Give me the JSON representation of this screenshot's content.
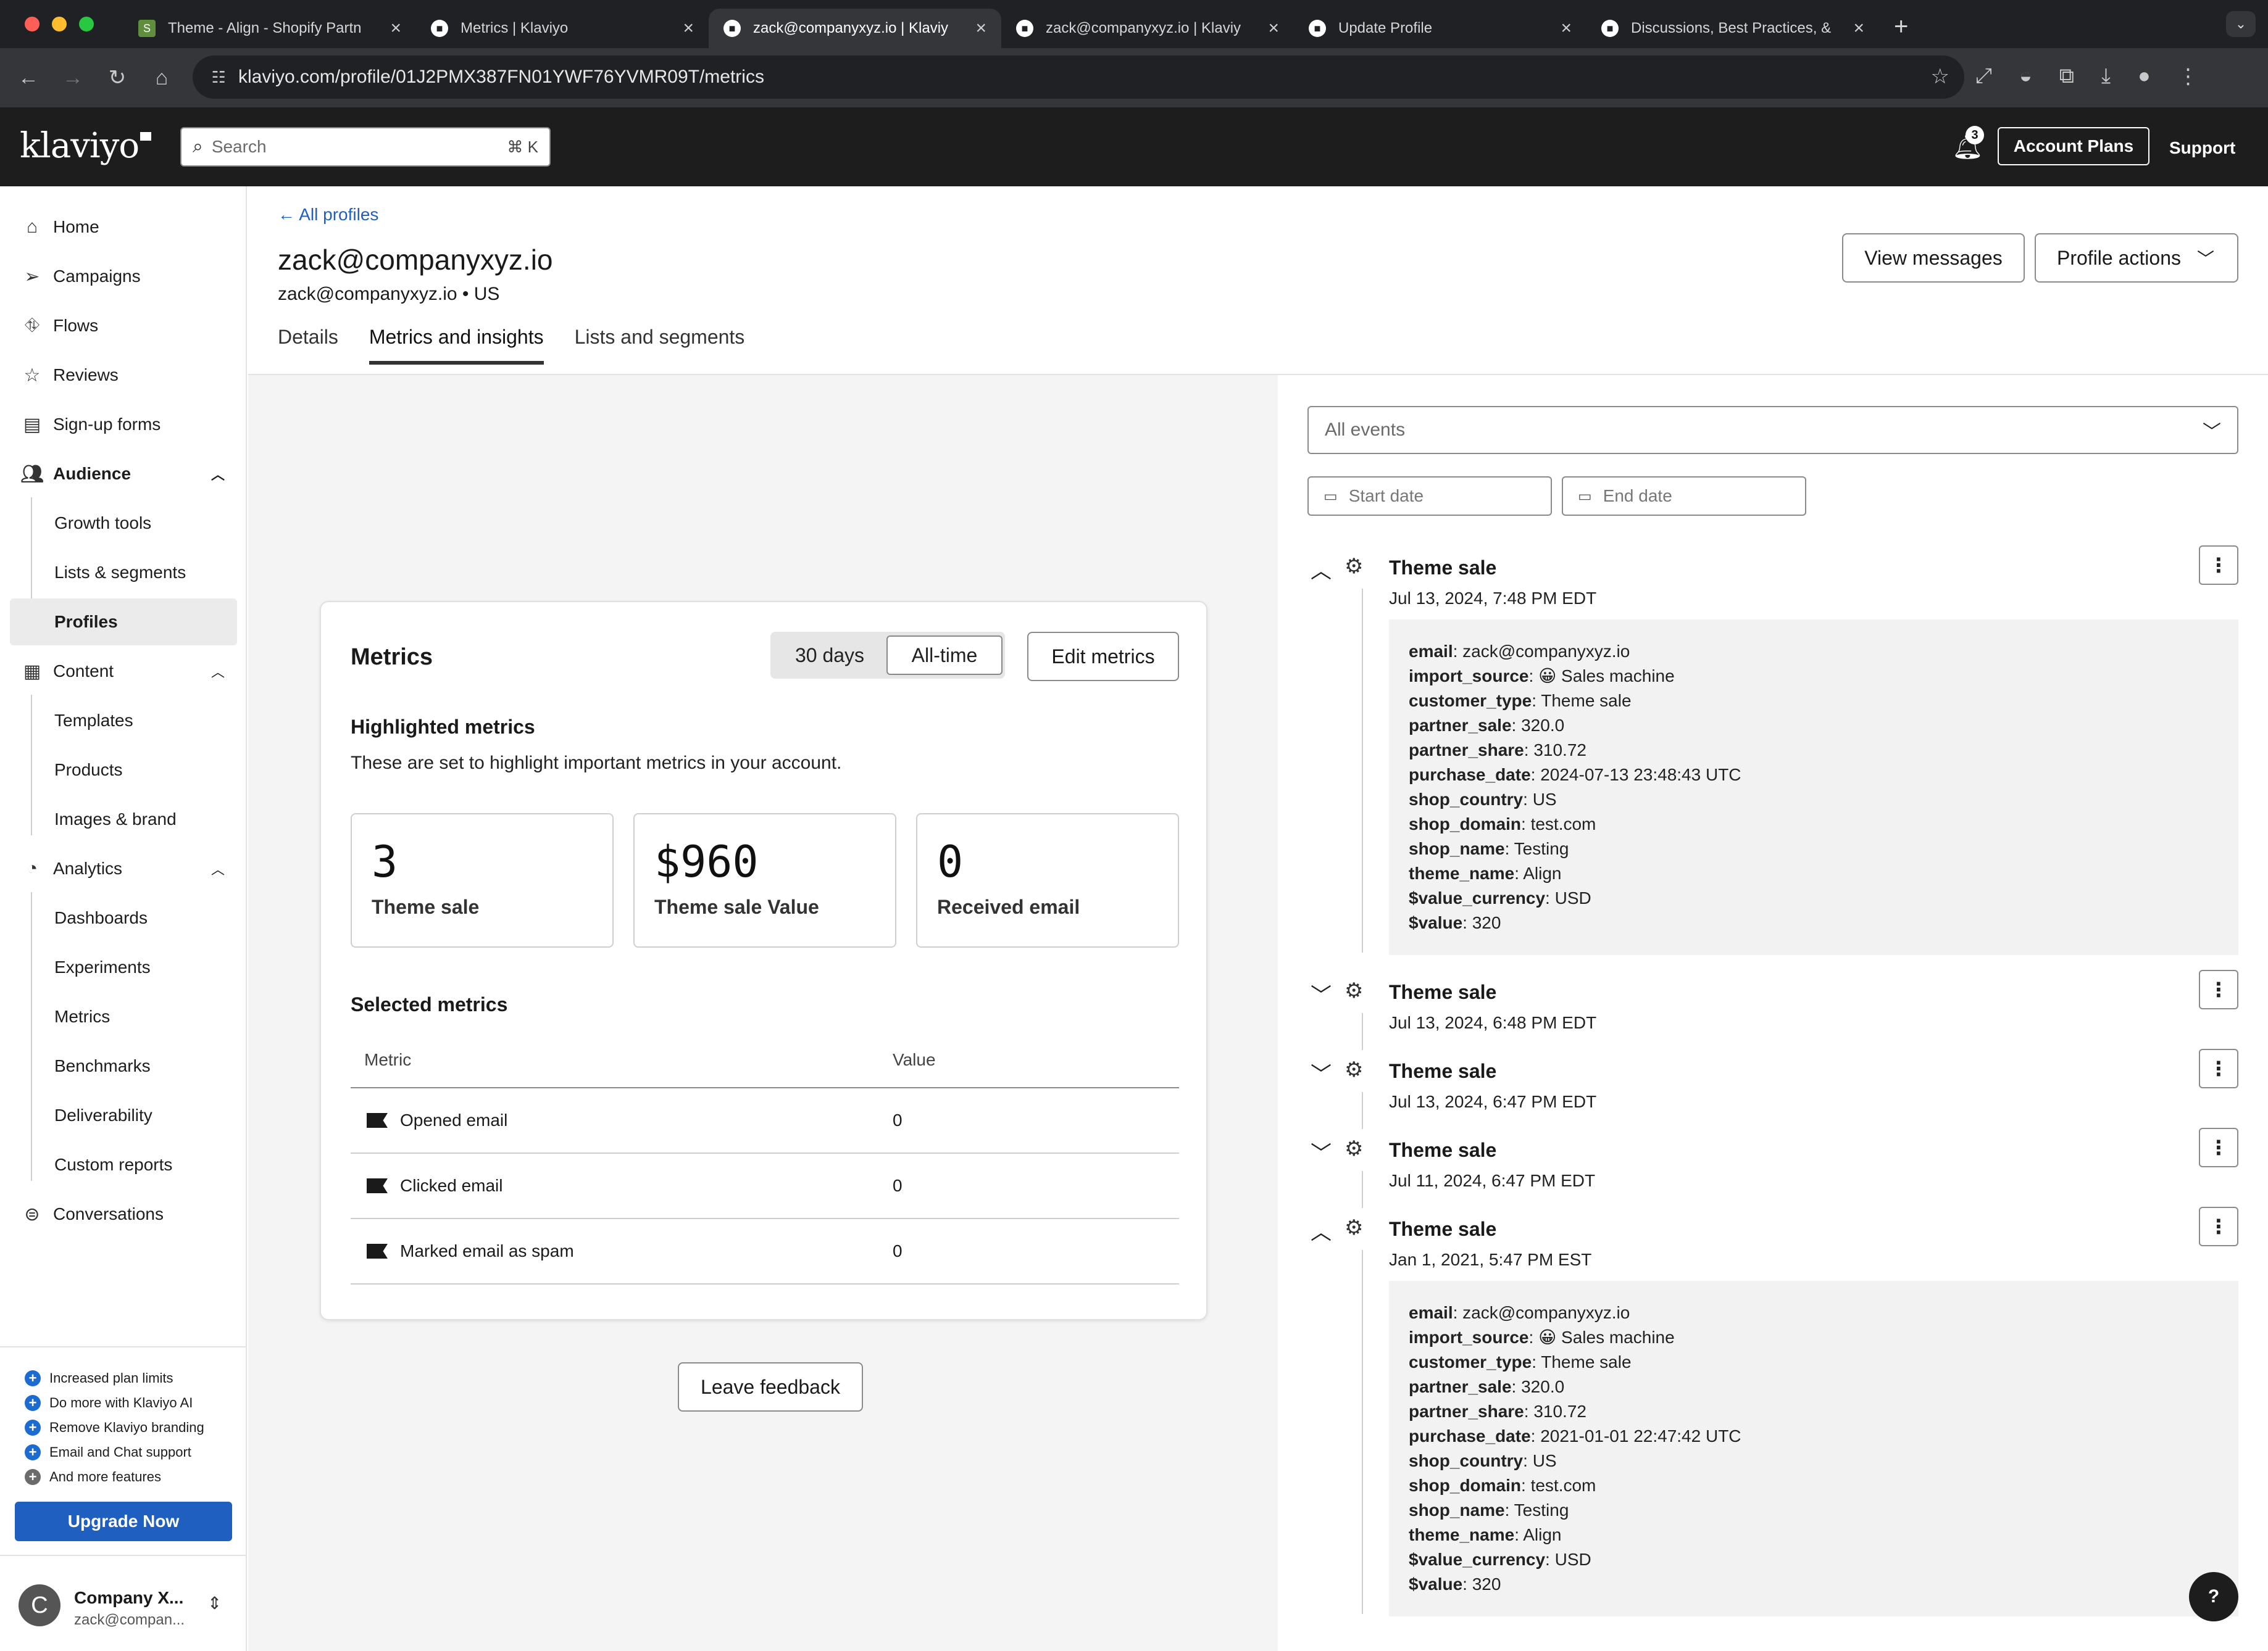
{
  "browser": {
    "tabs": [
      {
        "title": "Theme - Align - Shopify Partn",
        "favicon": "shopify-icon",
        "active": false
      },
      {
        "title": "Metrics | Klaviyo",
        "favicon": "klaviyo-icon",
        "active": false
      },
      {
        "title": "zack@companyxyz.io | Klaviy",
        "favicon": "klaviyo-icon",
        "active": true
      },
      {
        "title": "zack@companyxyz.io | Klaviy",
        "favicon": "klaviyo-icon",
        "active": false
      },
      {
        "title": "Update Profile",
        "favicon": "klaviyo-icon",
        "active": false
      },
      {
        "title": "Discussions, Best Practices, &",
        "favicon": "klaviyo-icon",
        "active": false
      }
    ],
    "url": "klaviyo.com/profile/01J2PMX387FN01YWF76YVMR09T/metrics"
  },
  "header": {
    "logo": "klaviyo",
    "search_placeholder": "Search",
    "search_shortcut": "⌘ K",
    "notifications_count": "3",
    "account_plans": "Account Plans",
    "support": "Support"
  },
  "sidebar": {
    "items": [
      {
        "label": "Home",
        "icon": "home-icon"
      },
      {
        "label": "Campaigns",
        "icon": "send-icon"
      },
      {
        "label": "Flows",
        "icon": "flows-icon"
      },
      {
        "label": "Reviews",
        "icon": "star-icon"
      },
      {
        "label": "Sign-up forms",
        "icon": "form-icon"
      },
      {
        "label": "Audience",
        "icon": "people-icon"
      },
      {
        "label": "Content",
        "icon": "content-icon"
      },
      {
        "label": "Analytics",
        "icon": "analytics-icon"
      },
      {
        "label": "Conversations",
        "icon": "chat-icon"
      }
    ],
    "audience_sub": [
      "Growth tools",
      "Lists & segments",
      "Profiles"
    ],
    "content_sub": [
      "Templates",
      "Products",
      "Images & brand"
    ],
    "analytics_sub": [
      "Dashboards",
      "Experiments",
      "Metrics",
      "Benchmarks",
      "Deliverability",
      "Custom reports"
    ],
    "upsell": [
      "Increased plan limits",
      "Do more with Klaviyo AI",
      "Remove Klaviyo branding",
      "Email and Chat support",
      "And more features"
    ],
    "upgrade_button": "Upgrade Now",
    "company": {
      "initial": "C",
      "name": "Company X...",
      "email": "zack@compan..."
    }
  },
  "profile": {
    "back_link": "All profiles",
    "title": "zack@companyxyz.io",
    "subtitle": "zack@companyxyz.io • US",
    "view_messages": "View messages",
    "profile_actions": "Profile actions",
    "tabs": [
      "Details",
      "Metrics and insights",
      "Lists and segments"
    ]
  },
  "metrics": {
    "title": "Metrics",
    "range_options": [
      "30 days",
      "All-time"
    ],
    "selected_range": "All-time",
    "edit_button": "Edit metrics",
    "highlighted_title": "Highlighted metrics",
    "highlighted_desc": "These are set to highlight important metrics in your account.",
    "highlighted": [
      {
        "value": "3",
        "label": "Theme sale"
      },
      {
        "value": "$960",
        "label": "Theme sale Value"
      },
      {
        "value": "0",
        "label": "Received email"
      }
    ],
    "selected_title": "Selected metrics",
    "table_headers": [
      "Metric",
      "Value"
    ],
    "rows": [
      {
        "metric": "Opened email",
        "value": "0"
      },
      {
        "metric": "Clicked email",
        "value": "0"
      },
      {
        "metric": "Marked email as spam",
        "value": "0"
      }
    ],
    "feedback_button": "Leave feedback"
  },
  "events": {
    "filter": "All events",
    "start_date_placeholder": "Start date",
    "end_date_placeholder": "End date",
    "list": [
      {
        "name": "Theme sale",
        "date": "Jul 13, 2024, 7:48 PM EDT",
        "expanded": true,
        "props": [
          {
            "k": "email",
            "v": "zack@companyxyz.io"
          },
          {
            "k": "import_source",
            "v": "😀 Sales machine"
          },
          {
            "k": "customer_type",
            "v": "Theme sale"
          },
          {
            "k": "partner_sale",
            "v": "320.0"
          },
          {
            "k": "partner_share",
            "v": "310.72"
          },
          {
            "k": "purchase_date",
            "v": "2024-07-13 23:48:43 UTC"
          },
          {
            "k": "shop_country",
            "v": "US"
          },
          {
            "k": "shop_domain",
            "v": "test.com"
          },
          {
            "k": "shop_name",
            "v": "Testing"
          },
          {
            "k": "theme_name",
            "v": "Align"
          },
          {
            "k": "$value_currency",
            "v": "USD"
          },
          {
            "k": "$value",
            "v": "320"
          }
        ]
      },
      {
        "name": "Theme sale",
        "date": "Jul 13, 2024, 6:48 PM EDT",
        "expanded": false,
        "props": []
      },
      {
        "name": "Theme sale",
        "date": "Jul 13, 2024, 6:47 PM EDT",
        "expanded": false,
        "props": []
      },
      {
        "name": "Theme sale",
        "date": "Jul 11, 2024, 6:47 PM EDT",
        "expanded": false,
        "props": []
      },
      {
        "name": "Theme sale",
        "date": "Jan 1, 2021, 5:47 PM EST",
        "expanded": true,
        "props": [
          {
            "k": "email",
            "v": "zack@companyxyz.io"
          },
          {
            "k": "import_source",
            "v": "😀 Sales machine"
          },
          {
            "k": "customer_type",
            "v": "Theme sale"
          },
          {
            "k": "partner_sale",
            "v": "320.0"
          },
          {
            "k": "partner_share",
            "v": "310.72"
          },
          {
            "k": "purchase_date",
            "v": "2021-01-01 22:47:42 UTC"
          },
          {
            "k": "shop_country",
            "v": "US"
          },
          {
            "k": "shop_domain",
            "v": "test.com"
          },
          {
            "k": "shop_name",
            "v": "Testing"
          },
          {
            "k": "theme_name",
            "v": "Align"
          },
          {
            "k": "$value_currency",
            "v": "USD"
          },
          {
            "k": "$value",
            "v": "320"
          }
        ]
      }
    ]
  },
  "help_button": "?"
}
